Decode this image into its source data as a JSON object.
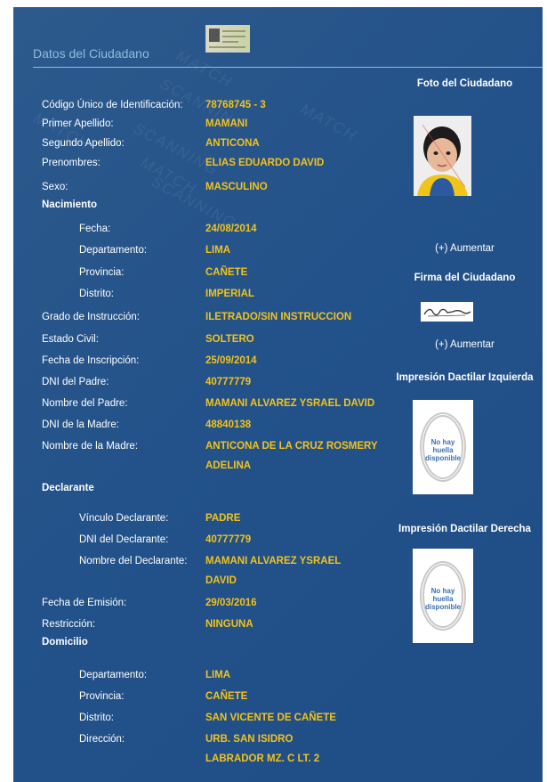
{
  "header": {
    "title": "Datos del Ciudadano"
  },
  "watermark": [
    "MATCH",
    "SCANNING",
    "MATCH",
    "SCANNING",
    "MATCH",
    "SCANNING",
    "MATCH"
  ],
  "fields": {
    "cui": {
      "label": "Código Único de Identificación:",
      "value": "78768745 - 3"
    },
    "primer_apellido": {
      "label": "Primer Apellido:",
      "value": "MAMANI"
    },
    "segundo_apellido": {
      "label": "Segundo Apellido:",
      "value": "ANTICONA"
    },
    "prenombres": {
      "label": "Prenombres:",
      "value": "ELIAS EDUARDO DAVID"
    },
    "sexo": {
      "label": "Sexo:",
      "value": "MASCULINO"
    },
    "grado": {
      "label": "Grado de Instrucción:",
      "value": "ILETRADO/SIN INSTRUCCION"
    },
    "estado_civil": {
      "label": "Estado Civil:",
      "value": "SOLTERO"
    },
    "fecha_inscripcion": {
      "label": "Fecha de Inscripción:",
      "value": "25/09/2014"
    },
    "dni_padre": {
      "label": "DNI del Padre:",
      "value": "40777779"
    },
    "nombre_padre": {
      "label": "Nombre del Padre:",
      "value": "MAMANI ALVAREZ YSRAEL DAVID"
    },
    "dni_madre": {
      "label": "DNI de la Madre:",
      "value": "48840138"
    },
    "nombre_madre": {
      "label": "Nombre de la Madre:",
      "value_line1": "ANTICONA DE LA CRUZ ROSMERY",
      "value_line2": "ADELINA"
    },
    "fecha_emision": {
      "label": "Fecha de Emisión:",
      "value": "29/03/2016"
    },
    "restriccion": {
      "label": "Restricción:",
      "value": "NINGUNA"
    }
  },
  "nacimiento": {
    "title": "Nacimiento",
    "fecha": {
      "label": "Fecha:",
      "value": "24/08/2014"
    },
    "departamento": {
      "label": "Departamento:",
      "value": "LIMA"
    },
    "provincia": {
      "label": "Provincia:",
      "value": "CAÑETE"
    },
    "distrito": {
      "label": "Distrito:",
      "value": "IMPERIAL"
    }
  },
  "declarante": {
    "title": "Declarante",
    "vinculo": {
      "label": "Vínculo Declarante:",
      "value": "PADRE"
    },
    "dni": {
      "label": "DNI del Declarante:",
      "value": "40777779"
    },
    "nombre": {
      "label": "Nombre del Declarante:",
      "value_line1": "MAMANI ALVAREZ YSRAEL",
      "value_line2": "DAVID"
    }
  },
  "domicilio": {
    "title": "Domicilio",
    "departamento": {
      "label": "Departamento:",
      "value": "LIMA"
    },
    "provincia": {
      "label": "Provincia:",
      "value": "CAÑETE"
    },
    "distrito": {
      "label": "Distrito:",
      "value": "SAN VICENTE DE CAÑETE"
    },
    "direccion": {
      "label": "Dirección:",
      "value_line1": "URB. SAN ISIDRO",
      "value_line2": "LABRADOR MZ. C LT. 2"
    }
  },
  "right": {
    "foto_title": "Foto del Ciudadano",
    "foto_aumentar": "(+) Aumentar",
    "firma_title": "Firma del Ciudadano",
    "firma_aumentar": "(+) Aumentar",
    "huella_izq_title": "Impresión Dactilar Izquierda",
    "huella_der_title": "Impresión Dactilar Derecha",
    "no_huella": [
      "No hay",
      "huella",
      "disponible"
    ]
  },
  "colors": {
    "panel": "#23528a",
    "value": "#f2c21b",
    "header": "#8fbce0"
  }
}
